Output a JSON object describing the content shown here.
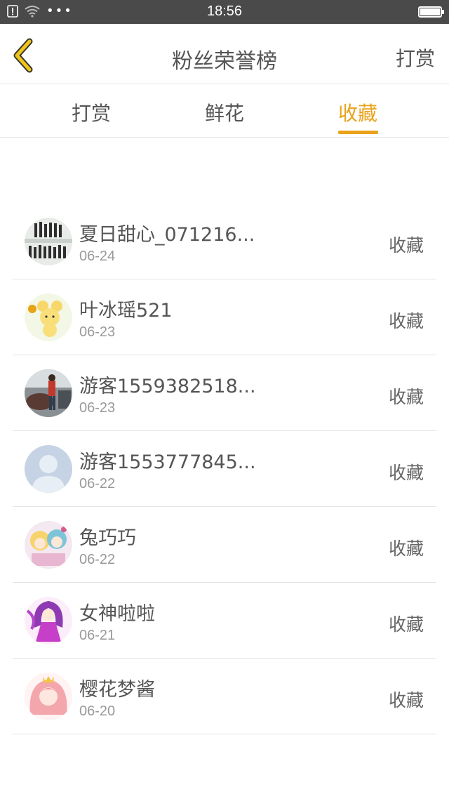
{
  "status_bar": {
    "time": "18:56",
    "dots": "•••"
  },
  "header": {
    "title": "粉丝荣誉榜",
    "action": "打赏"
  },
  "tabs": [
    {
      "label": "打赏",
      "active": false
    },
    {
      "label": "鲜花",
      "active": false
    },
    {
      "label": "收藏",
      "active": true
    }
  ],
  "colors": {
    "accent": "#e9a219",
    "status_bar": "#4a4a4a",
    "divider": "#e4e4e4"
  },
  "list": [
    {
      "name": "夏日甜心_071216...",
      "date": "06-24",
      "action": "收藏",
      "avatar": "group-photo-avatar"
    },
    {
      "name": "叶冰瑶521",
      "date": "06-23",
      "action": "收藏",
      "avatar": "cartoon-mouse-avatar"
    },
    {
      "name": "游客1559382518...",
      "date": "06-23",
      "action": "收藏",
      "avatar": "street-photo-avatar"
    },
    {
      "name": "游客1553777845...",
      "date": "06-22",
      "action": "收藏",
      "avatar": "default-user-avatar"
    },
    {
      "name": "兔巧巧",
      "date": "06-22",
      "action": "收藏",
      "avatar": "anime-girls-avatar"
    },
    {
      "name": "女神啦啦",
      "date": "06-21",
      "action": "收藏",
      "avatar": "anime-purple-avatar"
    },
    {
      "name": "樱花梦酱",
      "date": "06-20",
      "action": "收藏",
      "avatar": "anime-pink-avatar"
    }
  ]
}
